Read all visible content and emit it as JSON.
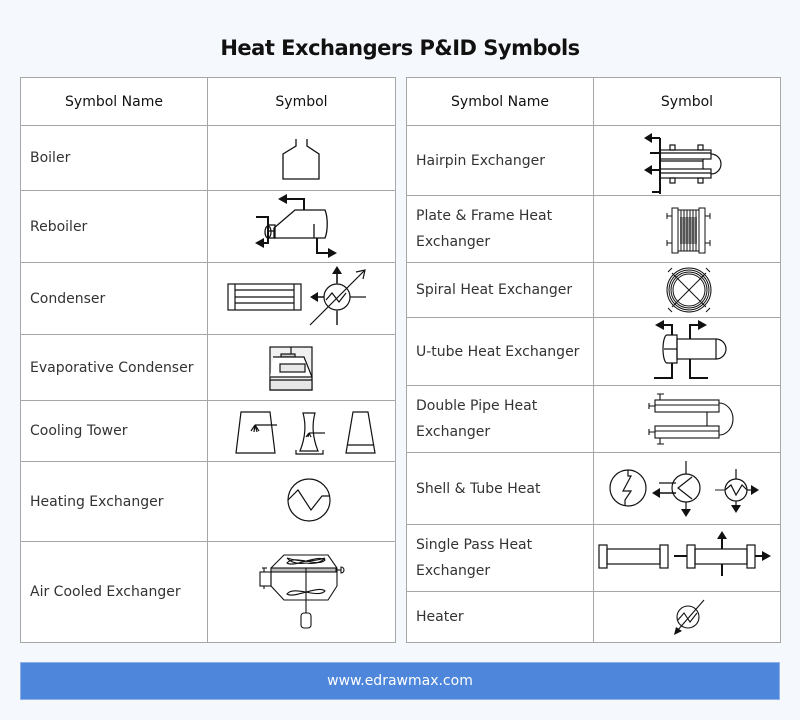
{
  "title": "Heat Exchangers P&ID Symbols",
  "tables": [
    {
      "headers": {
        "name": "Symbol Name",
        "symbol": "Symbol"
      },
      "rows": [
        {
          "name": "Boiler",
          "icon": "boiler-symbol"
        },
        {
          "name": "Reboiler",
          "icon": "reboiler-symbol"
        },
        {
          "name": "Condenser",
          "icon": "condenser-symbol"
        },
        {
          "name": "Evaporative Condenser",
          "icon": "evaporative-condenser-symbol"
        },
        {
          "name": "Cooling Tower",
          "icon": "cooling-tower-symbol"
        },
        {
          "name": "Heating Exchanger",
          "icon": "heating-exchanger-symbol"
        },
        {
          "name": "Air Cooled Exchanger",
          "icon": "air-cooled-exchanger-symbol"
        }
      ]
    },
    {
      "headers": {
        "name": "Symbol Name",
        "symbol": "Symbol"
      },
      "rows": [
        {
          "name": "Hairpin Exchanger",
          "icon": "hairpin-exchanger-symbol"
        },
        {
          "name": "Plate & Frame Heat Exchanger",
          "icon": "plate-frame-heat-exchanger-symbol"
        },
        {
          "name": "Spiral Heat Exchanger",
          "icon": "spiral-heat-exchanger-symbol"
        },
        {
          "name": "U-tube Heat Exchanger",
          "icon": "u-tube-heat-exchanger-symbol"
        },
        {
          "name": "Double Pipe Heat Exchanger",
          "icon": "double-pipe-heat-exchanger-symbol"
        },
        {
          "name": "Shell & Tube Heat",
          "icon": "shell-tube-heat-symbol"
        },
        {
          "name": "Single Pass Heat Exchanger",
          "icon": "single-pass-heat-exchanger-symbol"
        },
        {
          "name": "Heater",
          "icon": "heater-symbol"
        }
      ]
    }
  ],
  "footer": {
    "url": "www.edrawmax.com"
  },
  "colors": {
    "footer_bg": "#4d86da",
    "page_bg": "#f5f8fd",
    "border": "#a6a6a6"
  }
}
